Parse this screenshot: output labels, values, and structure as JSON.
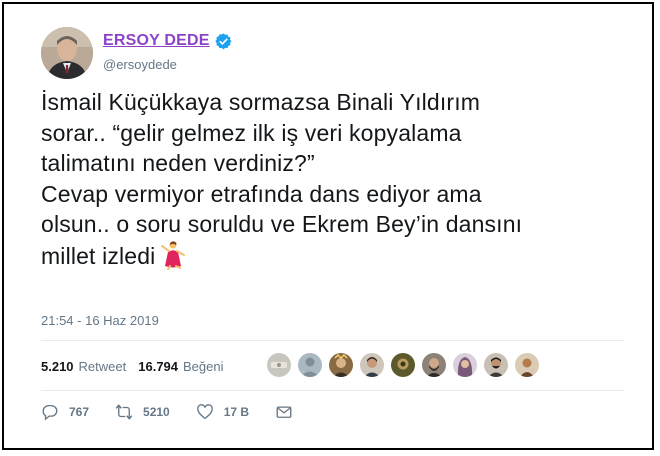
{
  "author": {
    "display_name": "ERSOY DEDE",
    "handle": "@ersoydede",
    "verified": true
  },
  "tweet": {
    "lines": [
      "İsmail Küçükkaya sormazsa Binali Yıldırım",
      "sorar.. “gelir gelmez ilk iş veri kopyalama",
      "talimatını neden verdiniz?”",
      "Cevap vermiyor etrafında dans ediyor ama",
      "olsun.. o soru soruldu ve Ekrem Bey’in dansını",
      "millet izledi"
    ],
    "emoji": "dancing-woman-emoji",
    "timestamp": "21:54 - 16 Haz 2019"
  },
  "stats": {
    "retweets_count": "5.210",
    "retweets_label": "Retweet",
    "likes_count": "16.794",
    "likes_label": "Beğeni"
  },
  "likers": [
    {
      "icon": "avatar-1",
      "color": "#c9c6c0"
    },
    {
      "icon": "avatar-2",
      "color": "#aab8c2"
    },
    {
      "icon": "avatar-3",
      "color": "#8a6a45"
    },
    {
      "icon": "avatar-4",
      "color": "#4a3d2f"
    },
    {
      "icon": "avatar-5",
      "color": "#5c5a2a"
    },
    {
      "icon": "avatar-6",
      "color": "#6b5a4a"
    },
    {
      "icon": "avatar-7",
      "color": "#7a5a78"
    },
    {
      "icon": "avatar-8",
      "color": "#3d3a35"
    },
    {
      "icon": "avatar-9",
      "color": "#9a6a40"
    }
  ],
  "actions": {
    "reply_count": "767",
    "retweet_count": "5210",
    "like_count": "17 B"
  },
  "colors": {
    "name": "#8c43c9",
    "verified": "#1da1f2",
    "muted": "#657786"
  }
}
